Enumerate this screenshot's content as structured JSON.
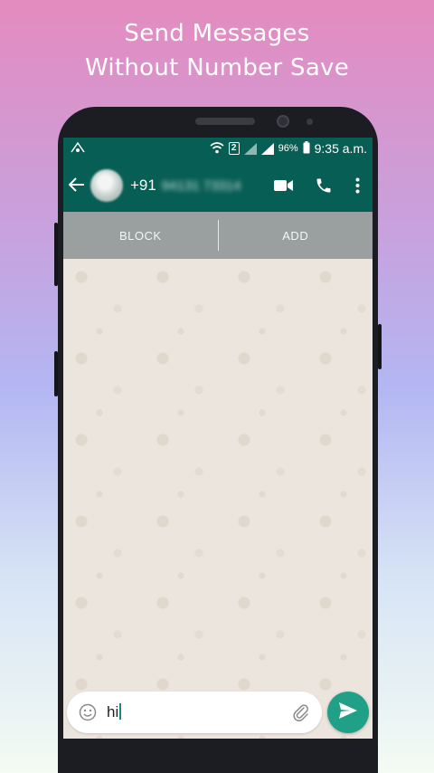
{
  "promo": {
    "line1": "Send Messages",
    "line2": "Without Number Save"
  },
  "statusbar": {
    "sim_slot": "2",
    "battery": "96%",
    "time": "9:35 a.m."
  },
  "appbar": {
    "back_icon": "arrow-back-icon",
    "country_code": "+91",
    "number_blurred": "94131 73314",
    "icons": [
      "video-call-icon",
      "phone-call-icon",
      "more-vert-icon"
    ]
  },
  "actions": {
    "block_label": "BLOCK",
    "add_label": "ADD"
  },
  "composer": {
    "text": "hi",
    "icons": [
      "emoji-icon",
      "attach-icon",
      "send-icon"
    ]
  },
  "colors": {
    "header": "#075e54",
    "send": "#20a086",
    "action_bar": "#9aa09f",
    "chat_bg": "#ece5dd"
  }
}
